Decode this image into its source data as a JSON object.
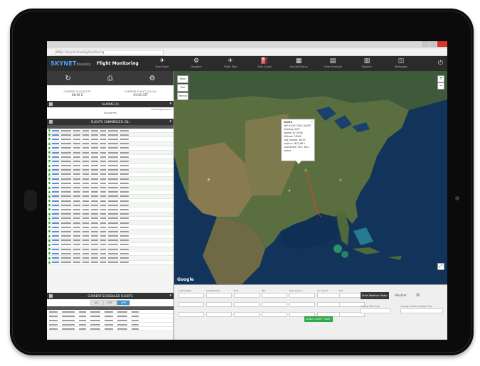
{
  "window": {
    "close_glyph": "✕"
  },
  "browser": {
    "url": "https://skynet.bluesky/monitoring"
  },
  "app": {
    "logo": "SKYNET",
    "logo_suffix": "bluesky",
    "title": "Flight Monitoring"
  },
  "toolbar": [
    {
      "icon": "✈",
      "label": "New Flight",
      "name": "new-flight"
    },
    {
      "icon": "⚙",
      "label": "Dispatch",
      "name": "dispatch"
    },
    {
      "icon": "✈",
      "label": "Flight Plan",
      "name": "flight-plan"
    },
    {
      "icon": "⛽",
      "label": "Fuel / Load",
      "name": "fuel"
    },
    {
      "icon": "▦",
      "label": "Aircraft Status",
      "name": "aircraft-status"
    },
    {
      "icon": "▤",
      "label": "Crew Schedule",
      "name": "crew-schedule"
    },
    {
      "icon": "▥",
      "label": "Reports",
      "name": "reports"
    },
    {
      "icon": "◫",
      "label": "Messages",
      "name": "messages"
    }
  ],
  "left": {
    "icons": [
      "↻",
      "⎙",
      "⚙"
    ],
    "available_left": "CURRENT FLIGHT/UTC",
    "available_left_val": "08:30 Z",
    "available_right": "CURRENT FLIGHT (LOCAL)",
    "available_right_val": "03:30 CST",
    "alarms_title": "ALARMS (0)",
    "alarms_note": "No alarms",
    "alarms_link": "Clear Flight Alarms",
    "flights_title": "FLIGHTS COMMENCED (31)",
    "scheduled_title": "CURRENT SCHEDULED FLIGHTS",
    "tabs": [
      "ALL",
      "DEP",
      "ARR"
    ]
  },
  "map": {
    "controls": [
      "Map",
      "Sat",
      "Terrain"
    ],
    "google": "Google",
    "popup": {
      "title": "N1234",
      "lines": [
        "SKY-FLIGHT 300 / ALERT",
        "Heading: 045°",
        "Speed: 421 KTAS",
        "Altitude: 35000",
        "Last Update: 08:29",
        "Lat/Lon: 38.2/-88.1",
        "Coordinate: 38.2 -88.1 Latest"
      ]
    }
  },
  "bottom": {
    "labels": [
      "Last Update",
      "Call Sign/Tail",
      "ETD",
      "ETA",
      "Dep Airport",
      "Arr Airport",
      "Pax"
    ],
    "green_button": "SEND FLIGHT PLAN / ROUTE",
    "dark_button": "Start Weather Radar",
    "weather_label": "Weather",
    "select_a": "Change Map Type",
    "select_b": "Change Overlay Display Time"
  }
}
